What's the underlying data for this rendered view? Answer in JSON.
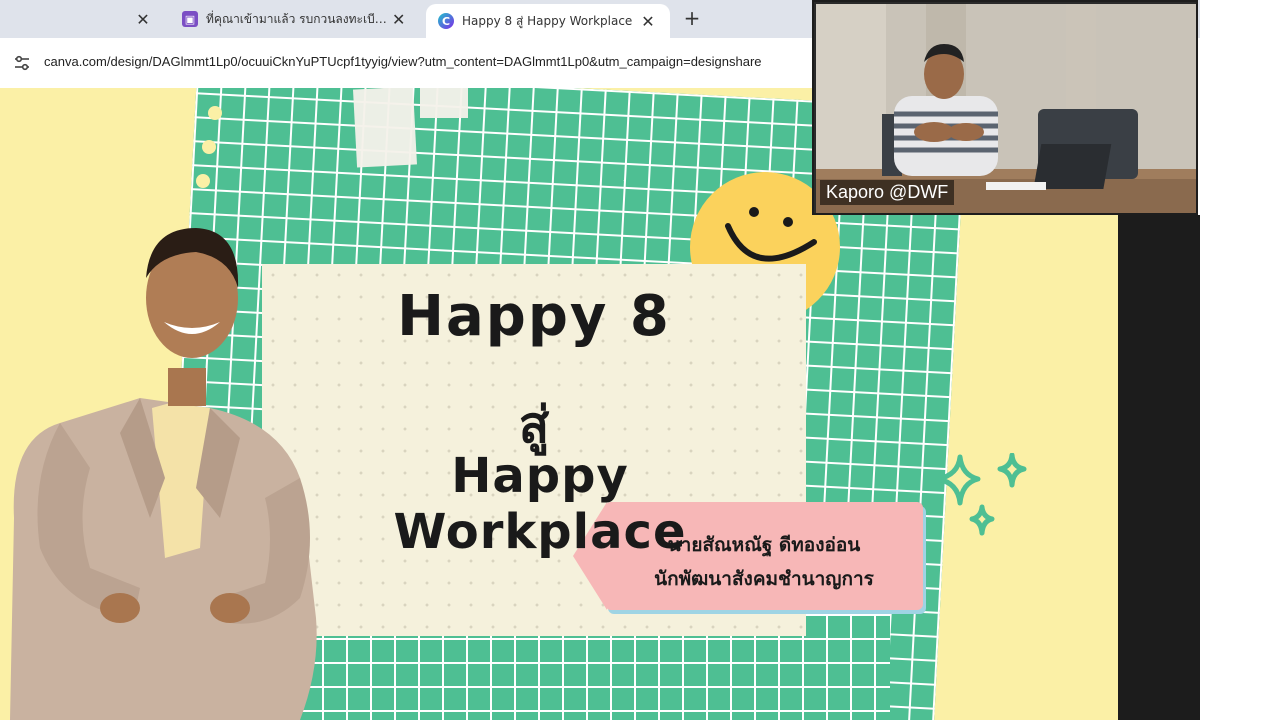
{
  "browser": {
    "tabs": [
      {
        "title": "",
        "active": false
      },
      {
        "title": "ที่คุณาเข้ามาแล้ว รบกวนลงทะเบียนอีก",
        "active": false,
        "icon": "workspace-icon"
      },
      {
        "title": "Happy 8 สู่ Happy Workplace",
        "active": true,
        "icon": "canva-icon"
      }
    ],
    "close_glyph": "✕",
    "new_tab_glyph": "+",
    "url": "canva.com/design/DAGlmmt1Lp0/ocuuiCknYuPTUcpf1tyyig/view?utm_content=DAGlmmt1Lp0&utm_campaign=designshare"
  },
  "slide": {
    "title_line1": "Happy 8",
    "title_line2": "สู่",
    "title_line3": "Happy Workplace",
    "presenter_name": "นายสัณหณัฐ ดีทองอ่อน",
    "presenter_role": "นักพัฒนาสังคมชำนาญการ",
    "colors": {
      "background": "#fbf0a6",
      "grid": "#4ebf93",
      "smiley": "#fbd25c",
      "tag": "#f7b7b7"
    }
  },
  "video": {
    "participant_label": "Kaporo @DWF"
  }
}
